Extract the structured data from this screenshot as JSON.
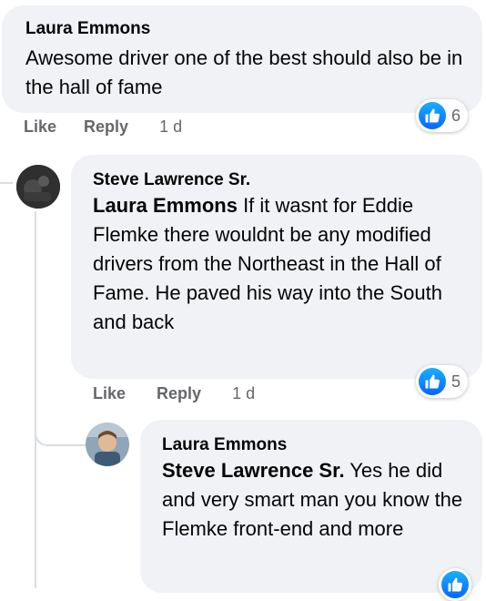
{
  "comments": [
    {
      "author": "Laura Emmons",
      "mention": "",
      "text": "Awesome driver one of the best should also be in the hall of fame",
      "reactions": "6",
      "like": "Like",
      "reply": "Reply",
      "time": "1 d"
    },
    {
      "author": "Steve Lawrence Sr.",
      "mention": "Laura Emmons",
      "text": "If it wasnt for Eddie Flemke there wouldnt be any modified drivers from the Northeast in the Hall of Fame. He paved his way into the South and back",
      "reactions": "5",
      "like": "Like",
      "reply": "Reply",
      "time": "1 d"
    },
    {
      "author": "Laura Emmons",
      "mention": "Steve Lawrence Sr.",
      "text": "Yes he did and very smart man you know the Flemke front-end and more"
    }
  ],
  "colors": {
    "bubble": "#f0f2f5",
    "meta_text": "#65676b",
    "like_blue": "#0866ff",
    "thread_line": "#dadde1"
  },
  "icons": {
    "reaction": "thumbs-up-icon"
  }
}
